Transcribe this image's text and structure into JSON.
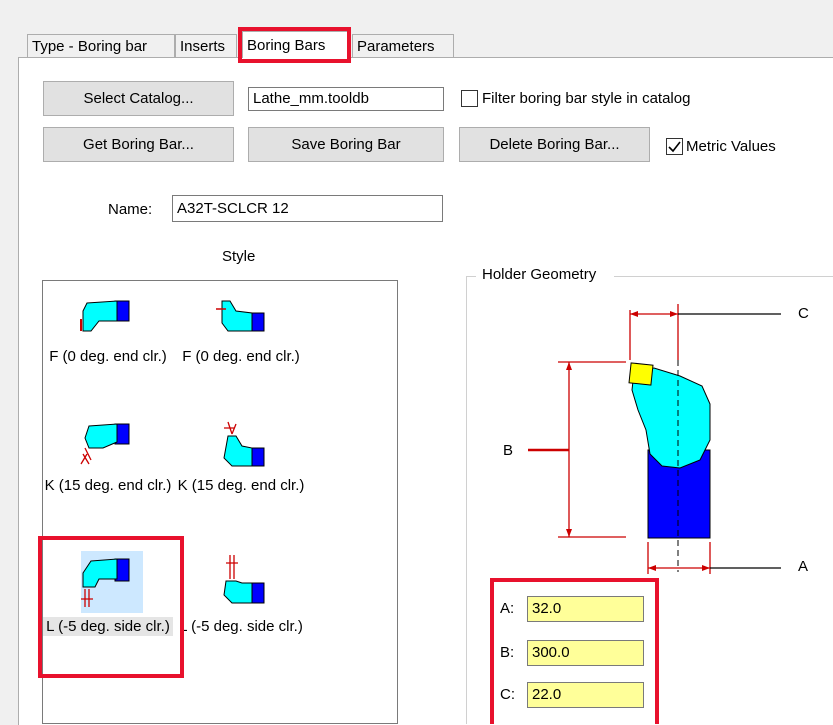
{
  "tabs": [
    {
      "label": "Type - Boring bar"
    },
    {
      "label": "Inserts"
    },
    {
      "label": "Boring Bars"
    },
    {
      "label": "Parameters"
    }
  ],
  "catalog": {
    "select_button": "Select Catalog...",
    "catalog_value": "Lathe_mm.tooldb",
    "filter_label": "Filter boring bar style in catalog",
    "filter_checked": false
  },
  "actions": {
    "get_button": "Get Boring Bar...",
    "save_button": "Save Boring Bar",
    "delete_button": "Delete Boring Bar...",
    "metric_label": "Metric Values",
    "metric_checked": true
  },
  "name": {
    "label": "Name:",
    "value": "A32T-SCLCR 12"
  },
  "style": {
    "title": "Style",
    "items": [
      {
        "caption": "F (0 deg. end clr.)"
      },
      {
        "caption": "F (0 deg. end clr.)"
      },
      {
        "caption": "K (15 deg. end clr.)"
      },
      {
        "caption": "K (15 deg. end clr.)"
      },
      {
        "caption": "L (-5 deg. side clr.)"
      },
      {
        "caption": "L (-5 deg. side clr.)"
      }
    ]
  },
  "geometry": {
    "title": "Holder Geometry",
    "label_a": "A",
    "label_b": "B",
    "label_c": "C",
    "fields": [
      {
        "label": "A:",
        "value": "32.0"
      },
      {
        "label": "B:",
        "value": "300.0"
      },
      {
        "label": "C:",
        "value": "22.0"
      }
    ]
  },
  "colors": {
    "highlight": "#e8112d",
    "field_bg": "#ffff99",
    "tool_cyan": "#00ffff",
    "tool_blue": "#0000ff",
    "insert_yellow": "#ffff00",
    "dim_red": "#cc0000"
  }
}
